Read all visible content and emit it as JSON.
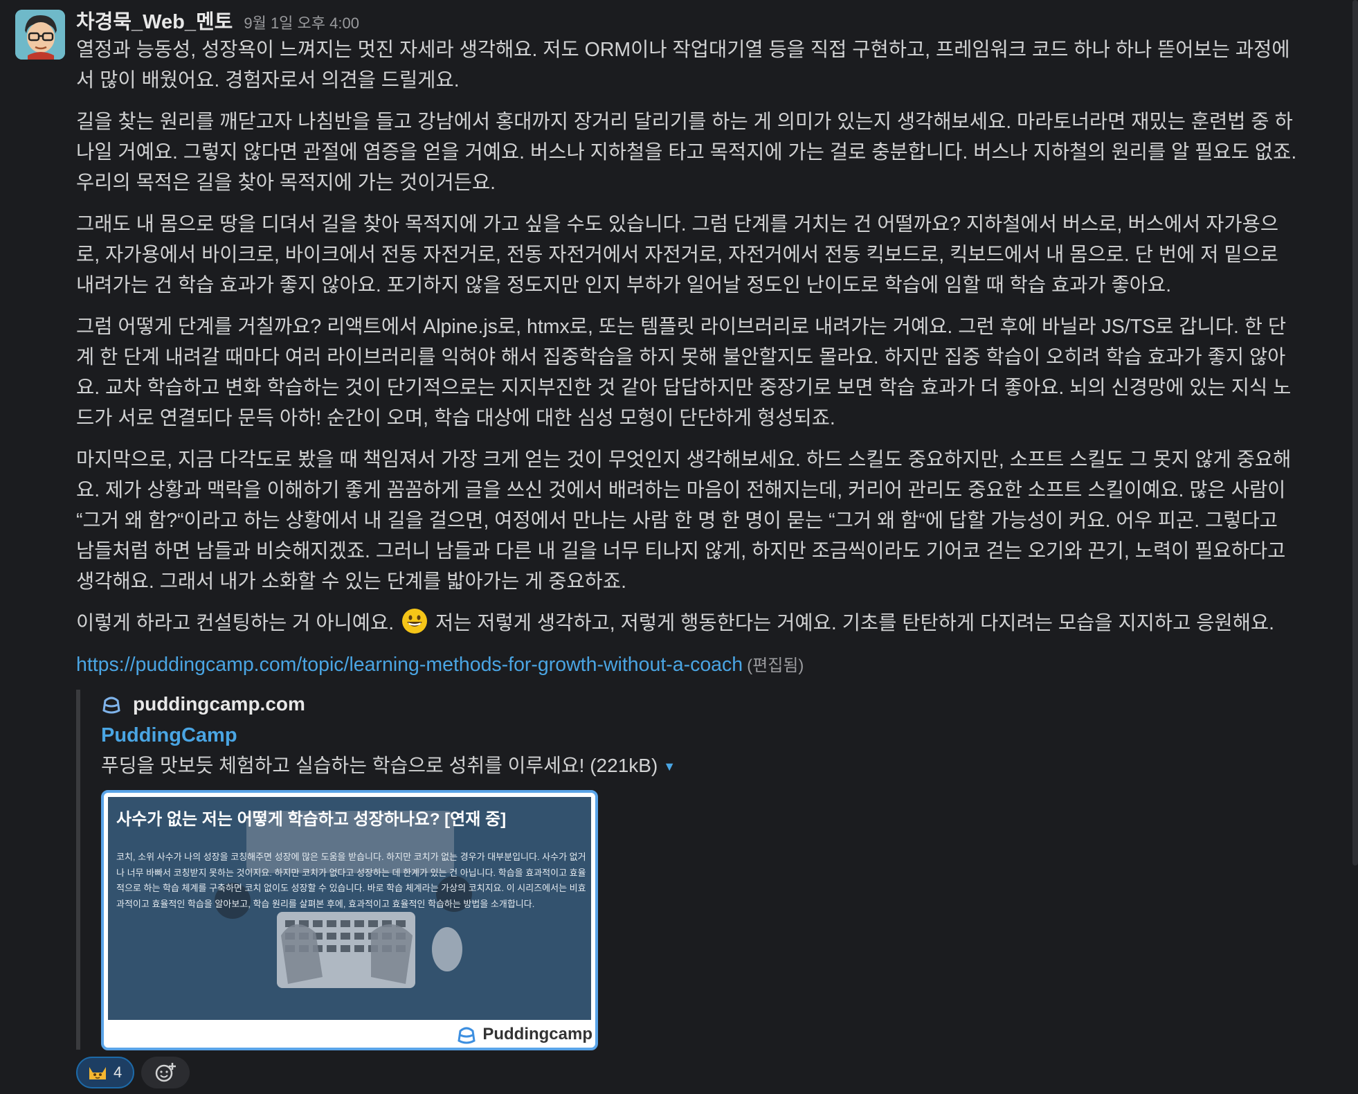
{
  "message": {
    "sender": "차경묵_Web_멘토",
    "timestamp": "9월 1일 오후 4:00",
    "paragraphs": [
      "열정과 능동성, 성장욕이 느껴지는 멋진 자세라 생각해요. 저도 ORM이나 작업대기열 등을 직접 구현하고, 프레임워크 코드 하나 하나 뜯어보는 과정에\n서 많이 배웠어요. 경험자로서 의견을 드릴게요.",
      "길을 찾는 원리를 깨닫고자 나침반을 들고 강남에서 홍대까지 장거리 달리기를 하는 게 의미가 있는지 생각해보세요. 마라토너라면 재밌는 훈련법 중 하\n나일 거예요. 그렇지 않다면 관절에 염증을 얻을 거예요. 버스나 지하철을 타고 목적지에 가는 걸로 충분합니다. 버스나 지하철의 원리를 알 필요도 없죠.\n우리의 목적은 길을 찾아 목적지에 가는 것이거든요.",
      "그래도 내 몸으로 땅을 디뎌서 길을 찾아 목적지에 가고 싶을 수도 있습니다. 그럼 단계를 거치는 건 어떨까요? 지하철에서 버스로, 버스에서 자가용으\n로, 자가용에서 바이크로, 바이크에서 전동 자전거로, 전동 자전거에서 자전거로, 자전거에서 전동 킥보드로, 킥보드에서 내 몸으로. 단 번에 저 밑으로\n내려가는 건 학습 효과가 좋지 않아요. 포기하지 않을 정도지만 인지 부하가 일어날 정도인 난이도로 학습에 임할 때 학습 효과가 좋아요.",
      "그럼 어떻게 단계를 거칠까요? 리액트에서 Alpine.js로, htmx로, 또는 템플릿 라이브러리로 내려가는 거예요. 그런 후에 바닐라 JS/TS로 갑니다. 한 단\n계 한 단계 내려갈 때마다 여러 라이브러리를 익혀야 해서 집중학습을 하지 못해 불안할지도 몰라요. 하지만 집중 학습이 오히려 학습 효과가 좋지 않아\n요. 교차 학습하고 변화 학습하는 것이 단기적으로는 지지부진한 것 같아 답답하지만 중장기로 보면 학습 효과가 더 좋아요. 뇌의 신경망에 있는 지식 노\n드가 서로 연결되다 문득 아하! 순간이 오며, 학습 대상에 대한 심성 모형이 단단하게 형성되죠.",
      "마지막으로, 지금 다각도로 봤을 때 책임져서 가장 크게 얻는 것이 무엇인지 생각해보세요. 하드 스킬도 중요하지만, 소프트 스킬도 그 못지 않게 중요해\n요. 제가 상황과 맥락을 이해하기 좋게 꼼꼼하게 글을 쓰신 것에서 배려하는 마음이 전해지는데, 커리어 관리도 중요한 소프트 스킬이예요. 많은 사람이\n“그거 왜 함?“이라고 하는 상황에서 내 길을 걸으면, 여정에서 만나는 사람 한 명 한 명이 묻는 “그거 왜 함“에 답할 가능성이 커요. 어우 피곤. 그렇다고\n남들처럼 하면 남들과 비슷해지겠죠. 그러니 남들과 다른 내 길을 너무 티나지 않게, 하지만 조금씩이라도 기어코 걷는 오기와 끈기, 노력이 필요하다고\n생각해요. 그래서 내가 소화할 수 있는 단계를 밟아가는 게 중요하죠."
    ],
    "last_para_before": "이렇게 하라고 컨설팅하는 거 아니예요. ",
    "last_para_after": " 저는 저렇게 생각하고, 저렇게 행동한다는 거예요. 기초를 탄탄하게 다지려는 모습을 지지하고 응원해요.",
    "link": "https://puddingcamp.com/topic/learning-methods-for-growth-without-a-coach",
    "edited": "(편집됨)"
  },
  "unfurl": {
    "site": "puddingcamp.com",
    "title": "PuddingCamp",
    "description": "푸딩을 맛보듯 체험하고 실습하는 학습으로 성취를 이루세요! (221kB)",
    "preview_title": "사수가 없는 저는 어떻게 학습하고 성장하나요? [연재 중]",
    "preview_desc": "코치, 소위 사수가 나의 성장을 코칭해주면 성장에 많은 도움을 받습니다. 하지만 코치가 없는 경우가 대부분입니다. 사수가 없거나 너무 바빠서 코칭받지 못하는 것이지요. 하지만 코치가 없다고 성장하는 데 한계가 있는 건 아닙니다. 학습을 효과적이고 효율적으로 하는 학습 체계를 구축하면 코치 없이도 성장할 수 있습니다. 바로 학습 체계라는 가상의 코치지요. 이 시리즈에서는 비효과적이고 효율적인 학습을 알아보고, 학습 원리를 살펴본 후에, 효과적이고 효율적인 학습하는 방법을 소개합니다.",
    "brand": "Puddingcamp"
  },
  "reactions": [
    {
      "emoji": "cat-emoji",
      "count": "4"
    },
    {
      "emoji": "add-reaction-icon"
    }
  ]
}
